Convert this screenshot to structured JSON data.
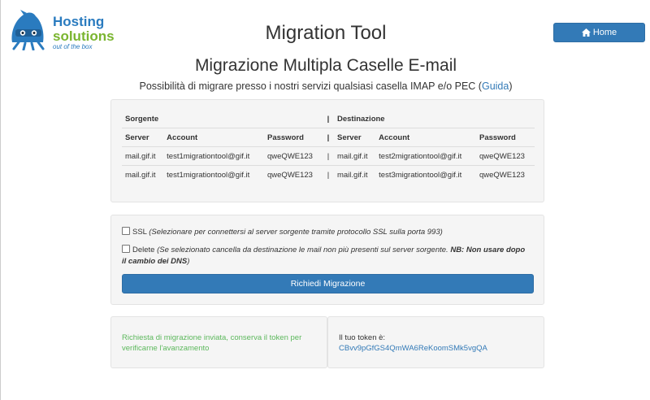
{
  "logo": {
    "line1": "Hosting",
    "line2": "solutions",
    "tagline": "out of the box"
  },
  "header": {
    "title": "Migration Tool",
    "home_label": "Home"
  },
  "main": {
    "subtitle": "Migrazione Multipla Caselle E-mail",
    "description_prefix": "Possibilità di migrare presso i nostri servizi qualsiasi casella IMAP e/o PEC (",
    "description_link": "Guida",
    "description_suffix": ")"
  },
  "table": {
    "group_source": "Sorgente",
    "group_dest": "Destinazione",
    "separator": "|",
    "columns": [
      "Server",
      "Account",
      "Password",
      "Server",
      "Account",
      "Password"
    ],
    "rows": [
      [
        "mail.gif.it",
        "test1migrationtool@gif.it",
        "qweQWE123",
        "mail.gif.it",
        "test2migrationtool@gif.it",
        "qweQWE123"
      ],
      [
        "mail.gif.it",
        "test1migrationtool@gif.it",
        "qweQWE123",
        "mail.gif.it",
        "test3migrationtool@gif.it",
        "qweQWE123"
      ]
    ]
  },
  "options": {
    "ssl_label": "SSL",
    "ssl_hint": "(Selezionare per connettersi al server sorgente tramite protocollo SSL sulla porta 993)",
    "delete_label": "Delete",
    "delete_hint_prefix": "(Se selezionato cancella da destinazione le mail non più presenti sul server sorgente. ",
    "delete_hint_bold": "NB: Non usare dopo il cambio dei DNS",
    "delete_hint_suffix": ")",
    "submit_label": "Richiedi Migrazione"
  },
  "status": {
    "message": "Richiesta di migrazione inviata, conserva il token per verificarne l'avanzamento",
    "token_label": "Il tuo token è:",
    "token_value": "CBvv9pGfGS4QmWA6ReKoomSMk5vgQA"
  },
  "colors": {
    "primary": "#337ab7",
    "success": "#5cb85c",
    "logo_blue": "#2a7bbf",
    "logo_green": "#7ab52f"
  }
}
